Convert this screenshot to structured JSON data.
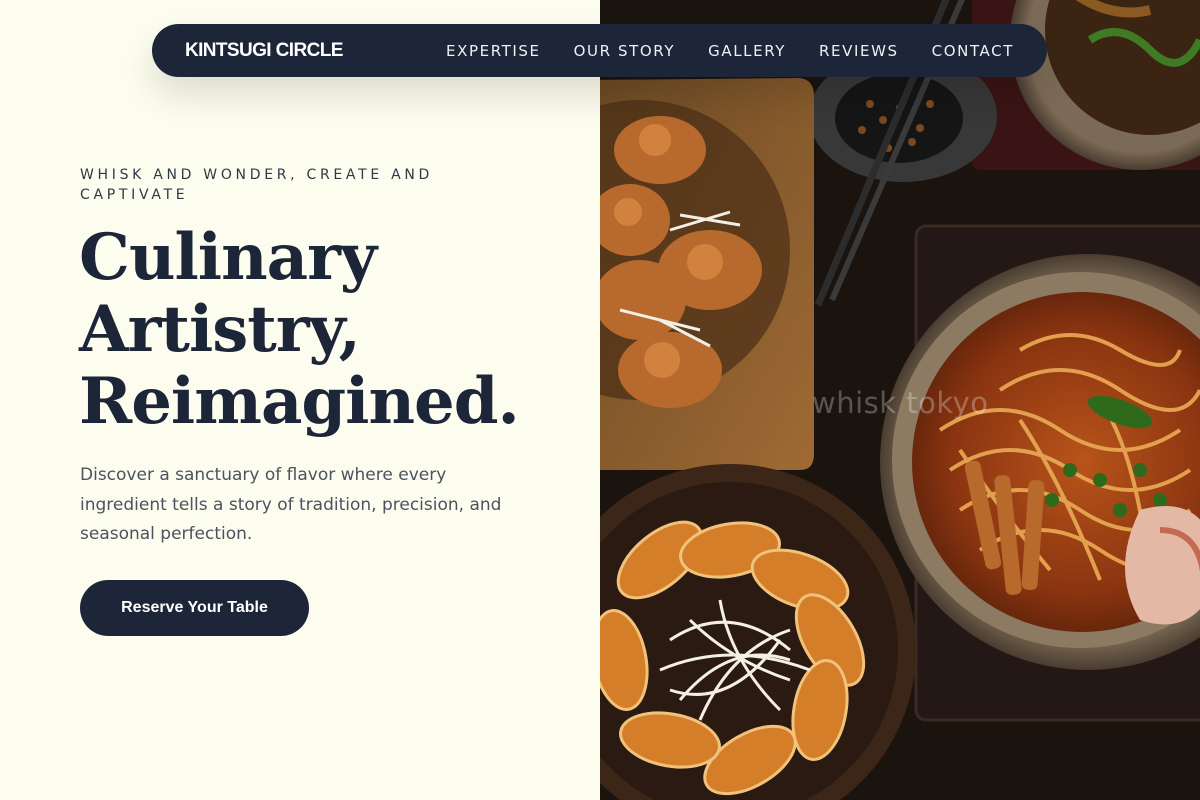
{
  "nav": {
    "brand": "KINTSUGI CIRCLE",
    "links": [
      "EXPERTISE",
      "OUR STORY",
      "GALLERY",
      "REVIEWS",
      "CONTACT"
    ]
  },
  "hero": {
    "eyebrow": "WHISK AND WONDER, CREATE AND CAPTIVATE",
    "headline_lines": [
      "Culinary",
      "Artistry,",
      "Reimagined."
    ],
    "description": "Discover a sanctuary of flavor where every ingredient tells a story of tradition, precision, and seasonal perfection.",
    "cta_label": "Reserve Your Table"
  },
  "photo": {
    "watermark": "whisk tokyo"
  },
  "colors": {
    "background": "#fdfdef",
    "navy": "#1c2638",
    "body_text": "#4b5260"
  }
}
